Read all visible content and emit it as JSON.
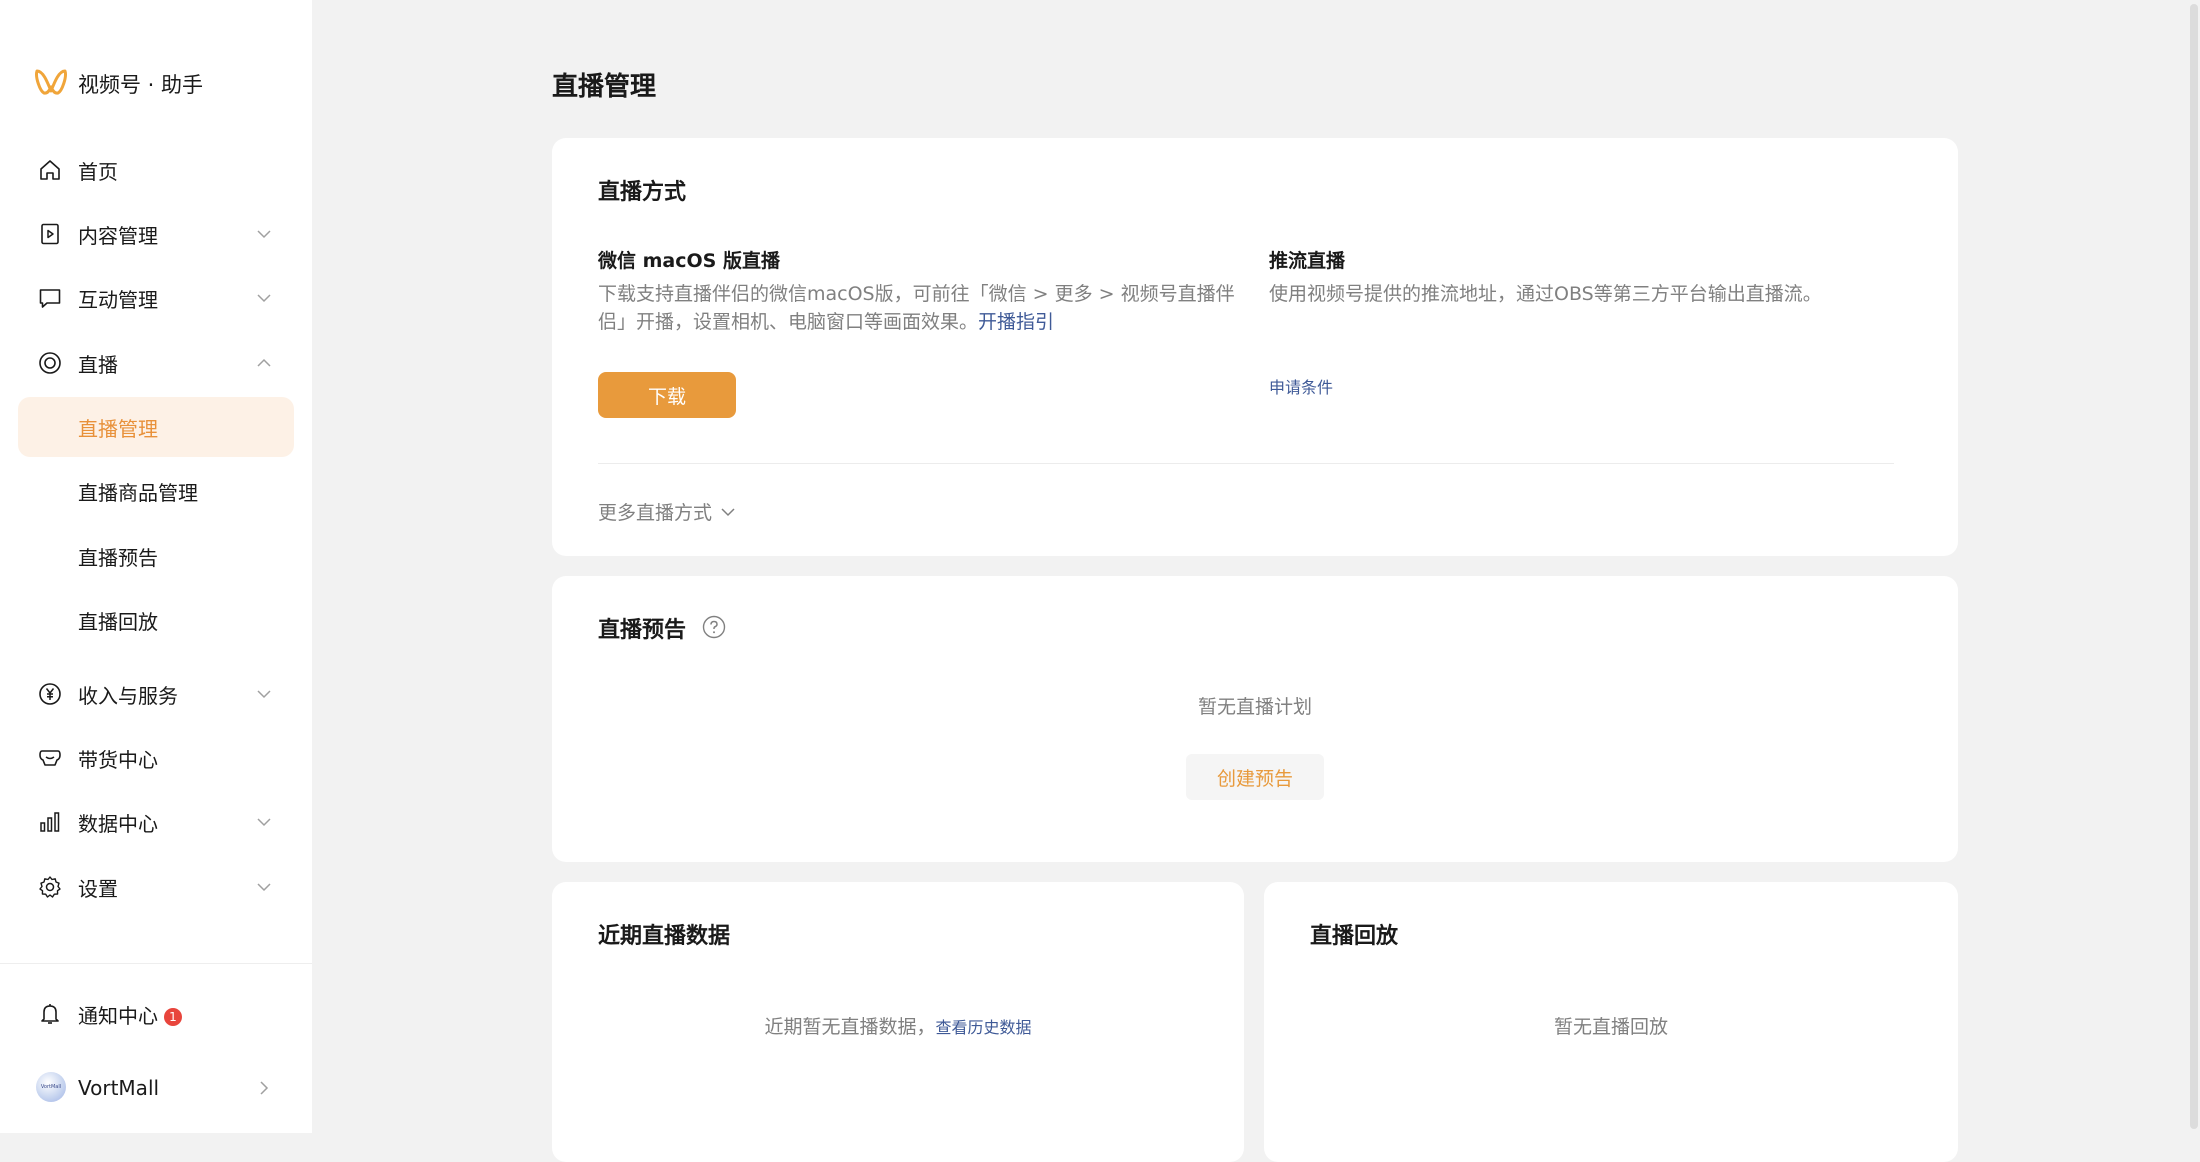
{
  "app": {
    "title": "视频号 · 助手"
  },
  "sidebar": {
    "items": [
      {
        "label": "首页"
      },
      {
        "label": "内容管理"
      },
      {
        "label": "互动管理"
      },
      {
        "label": "直播"
      },
      {
        "label": "直播管理"
      },
      {
        "label": "直播商品管理"
      },
      {
        "label": "直播预告"
      },
      {
        "label": "直播回放"
      },
      {
        "label": "收入与服务"
      },
      {
        "label": "带货中心"
      },
      {
        "label": "数据中心"
      },
      {
        "label": "设置"
      }
    ],
    "notification": {
      "label": "通知中心",
      "count": "1"
    },
    "account": {
      "name": "VortMall",
      "avatar_text": "VortMall"
    }
  },
  "page": {
    "title": "直播管理"
  },
  "methods_card": {
    "title": "直播方式",
    "mac": {
      "title": "微信 macOS 版直播",
      "desc": "下载支持直播伴侣的微信macOS版，可前往「微信 > 更多 > 视频号直播伴侣」开播，设置相机、电脑窗口等画面效果。",
      "link": "开播指引",
      "button": "下载"
    },
    "push": {
      "title": "推流直播",
      "desc": "使用视频号提供的推流地址，通过OBS等第三方平台输出直播流。",
      "link": "申请条件"
    },
    "more": "更多直播方式"
  },
  "preview_card": {
    "title": "直播预告",
    "empty": "暂无直播计划",
    "button": "创建预告"
  },
  "recent_card": {
    "title": "近期直播数据",
    "empty": "近期暂无直播数据，",
    "link": "查看历史数据"
  },
  "replay_card": {
    "title": "直播回放",
    "empty": "暂无直播回放"
  },
  "colors": {
    "accent": "#e89a3c",
    "active_bg": "#fdf1e6",
    "link": "#3f5a97",
    "badge": "#e8453c",
    "page_bg": "#f2f2f2"
  }
}
